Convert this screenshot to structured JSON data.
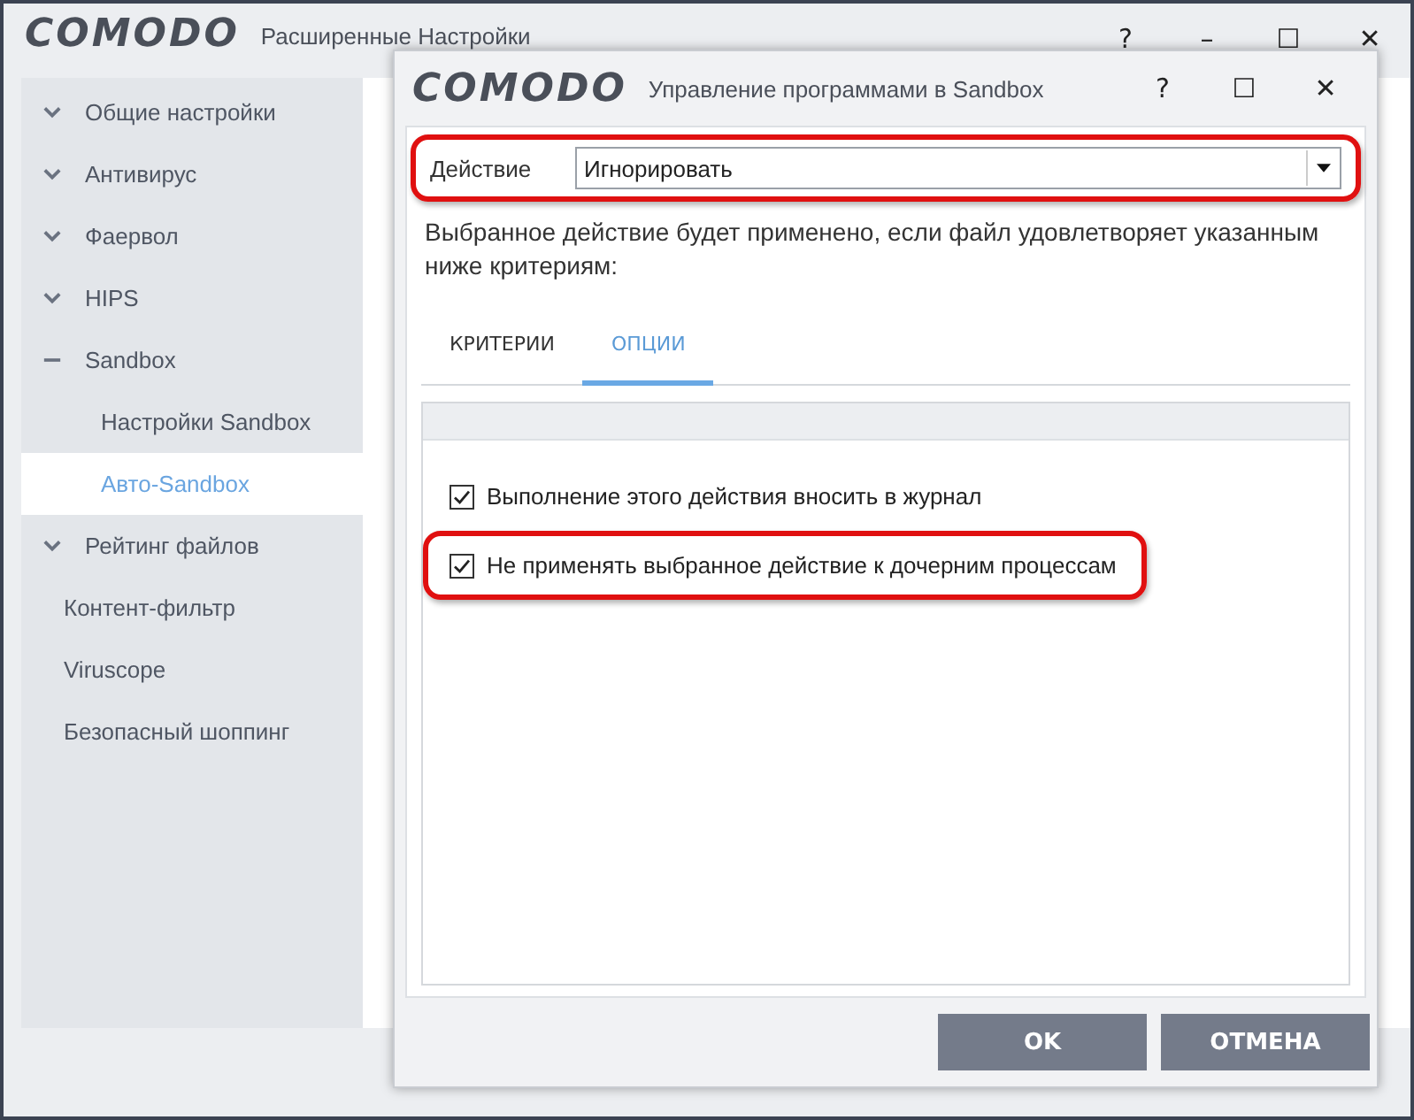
{
  "window": {
    "logo": "COMODO",
    "title": "Расширенные Настройки",
    "controls": [
      "?",
      "–",
      "☐",
      "✕"
    ]
  },
  "sidebar": {
    "items": [
      {
        "label": "Общие настройки",
        "kind": "group",
        "expanded": false,
        "selected": false
      },
      {
        "label": "Антивирус",
        "kind": "group",
        "expanded": false,
        "selected": false
      },
      {
        "label": "Фаервол",
        "kind": "group",
        "expanded": false,
        "selected": false
      },
      {
        "label": "HIPS",
        "kind": "group",
        "expanded": false,
        "selected": false
      },
      {
        "label": "Sandbox",
        "kind": "group",
        "expanded": true,
        "selected": false,
        "children": [
          {
            "label": "Настройки Sandbox",
            "selected": false
          },
          {
            "label": "Авто-Sandbox",
            "selected": true
          }
        ]
      },
      {
        "label": "Рейтинг файлов",
        "kind": "group",
        "expanded": false,
        "selected": false
      },
      {
        "label": "Контент-фильтр",
        "kind": "leaf",
        "selected": false
      },
      {
        "label": "Viruscope",
        "kind": "leaf",
        "selected": false
      },
      {
        "label": "Безопасный шоппинг",
        "kind": "leaf",
        "selected": false
      }
    ]
  },
  "dialog": {
    "logo": "COMODO",
    "title": "Управление программами в Sandbox",
    "controls": [
      "?",
      "☐",
      "✕"
    ],
    "action": {
      "label": "Действие",
      "value": "Игнорировать",
      "highlighted": true
    },
    "description": "Выбранное действие будет применено, если файл удовлетворяет указанным ниже критериям:",
    "tabs": [
      {
        "label": "КРИТЕРИИ",
        "selected": false
      },
      {
        "label": "ОПЦИИ",
        "selected": true
      }
    ],
    "options": [
      {
        "label": "Выполнение этого действия вносить в журнал",
        "checked": true,
        "highlighted": false
      },
      {
        "label": "Не применять выбранное действие к дочерним процессам",
        "checked": true,
        "highlighted": true
      }
    ],
    "buttons": [
      "OK",
      "ОТМЕНА"
    ]
  }
}
